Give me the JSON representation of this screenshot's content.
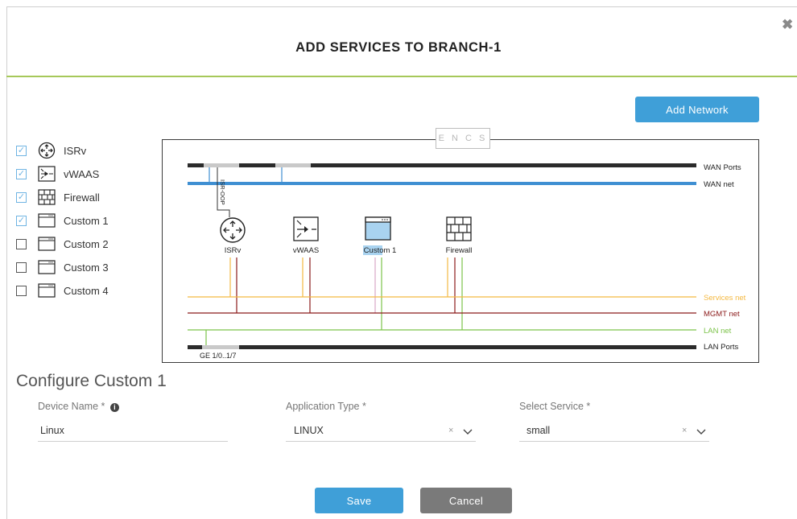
{
  "dialog": {
    "title": "ADD SERVICES TO BRANCH-1",
    "close_glyph": "✖"
  },
  "toolbar": {
    "add_network_label": "Add Network"
  },
  "services": [
    {
      "label": "ISRv",
      "checked": true,
      "icon": "router-icon"
    },
    {
      "label": "vWAAS",
      "checked": true,
      "icon": "wan-optimizer-icon"
    },
    {
      "label": "Firewall",
      "checked": true,
      "icon": "firewall-icon"
    },
    {
      "label": "Custom 1",
      "checked": true,
      "icon": "window-icon"
    },
    {
      "label": "Custom 2",
      "checked": false,
      "icon": "window-icon"
    },
    {
      "label": "Custom 3",
      "checked": false,
      "icon": "window-icon"
    },
    {
      "label": "Custom 4",
      "checked": false,
      "icon": "window-icon"
    }
  ],
  "diagram": {
    "chassis_label": "E N C S",
    "wan_tap_label": "ISR-OOP",
    "buses": {
      "wan_ports": "WAN Ports",
      "wan_net": "WAN net",
      "services_net": "Services net",
      "mgmt_net": "MGMT net",
      "lan_net": "LAN net",
      "lan_ports": "LAN Ports"
    },
    "nodes": [
      {
        "label": "ISRv",
        "icon": "router-icon"
      },
      {
        "label": "vWAAS",
        "icon": "wan-optimizer-icon"
      },
      {
        "label": "Custom 1",
        "icon": "window-icon",
        "selected": true
      },
      {
        "label": "Firewall",
        "icon": "firewall-icon"
      }
    ],
    "port_range_label": "GE 1/0..1/7",
    "colors": {
      "wan_net": "#3f8fd2",
      "services_net": "#f4b942",
      "mgmt_net": "#8b1a1a",
      "lan_net": "#7cc34a",
      "ports_bar": "#2b2b2b",
      "selected_highlight": "#a9d3f0"
    }
  },
  "configure": {
    "title": "Configure Custom 1",
    "device_name_label": "Device Name *",
    "device_name_value": "Linux",
    "app_type_label": "Application Type *",
    "app_type_value": "LINUX",
    "select_service_label": "Select Service *",
    "select_service_value": "small",
    "clear_glyph": "×"
  },
  "actions": {
    "save_label": "Save",
    "cancel_label": "Cancel"
  },
  "accent": "#3f9fd8",
  "divider_color": "#a6c85a"
}
